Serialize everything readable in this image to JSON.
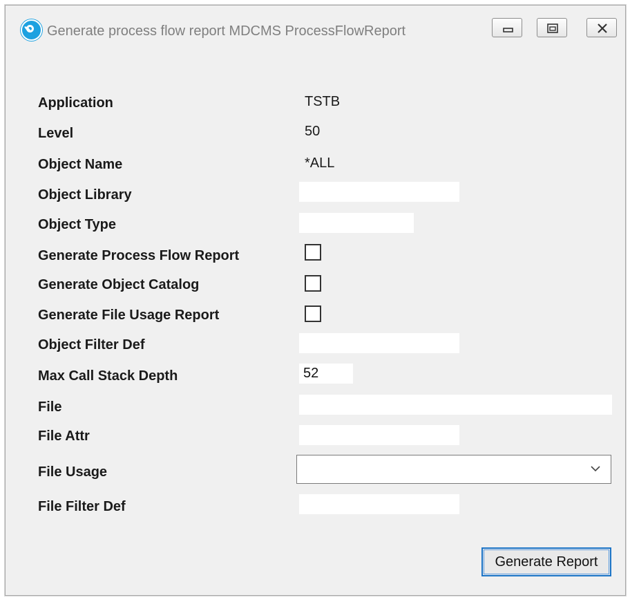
{
  "window": {
    "title": "Generate process flow report MDCMS ProcessFlowReport",
    "app_icon": "app-logo-icon",
    "controls": [
      "minimize-icon",
      "restore-icon",
      "close-icon"
    ]
  },
  "form": {
    "application": {
      "label": "Application",
      "value": "TSTB"
    },
    "level": {
      "label": "Level",
      "value": "50"
    },
    "object_name": {
      "label": "Object Name",
      "value": "*ALL"
    },
    "object_library": {
      "label": "Object Library",
      "value": ""
    },
    "object_type": {
      "label": "Object Type",
      "value": ""
    },
    "gen_process_flow": {
      "label": "Generate Process Flow Report",
      "checked": false
    },
    "gen_object_catalog": {
      "label": "Generate Object Catalog",
      "checked": false
    },
    "gen_file_usage": {
      "label": "Generate File Usage Report",
      "checked": false
    },
    "object_filter_def": {
      "label": "Object Filter Def",
      "value": ""
    },
    "max_call_stack_depth": {
      "label": "Max Call Stack Depth",
      "value": "52"
    },
    "file": {
      "label": "File",
      "value": ""
    },
    "file_attr": {
      "label": "File Attr",
      "value": ""
    },
    "file_usage": {
      "label": "File Usage",
      "selected": ""
    },
    "file_filter_def": {
      "label": "File Filter Def",
      "value": ""
    }
  },
  "actions": {
    "generate_report": "Generate Report"
  },
  "colors": {
    "background": "#f0f0f0",
    "focus_border": "#1b74c7",
    "icon_blue": "#1da1e0"
  }
}
